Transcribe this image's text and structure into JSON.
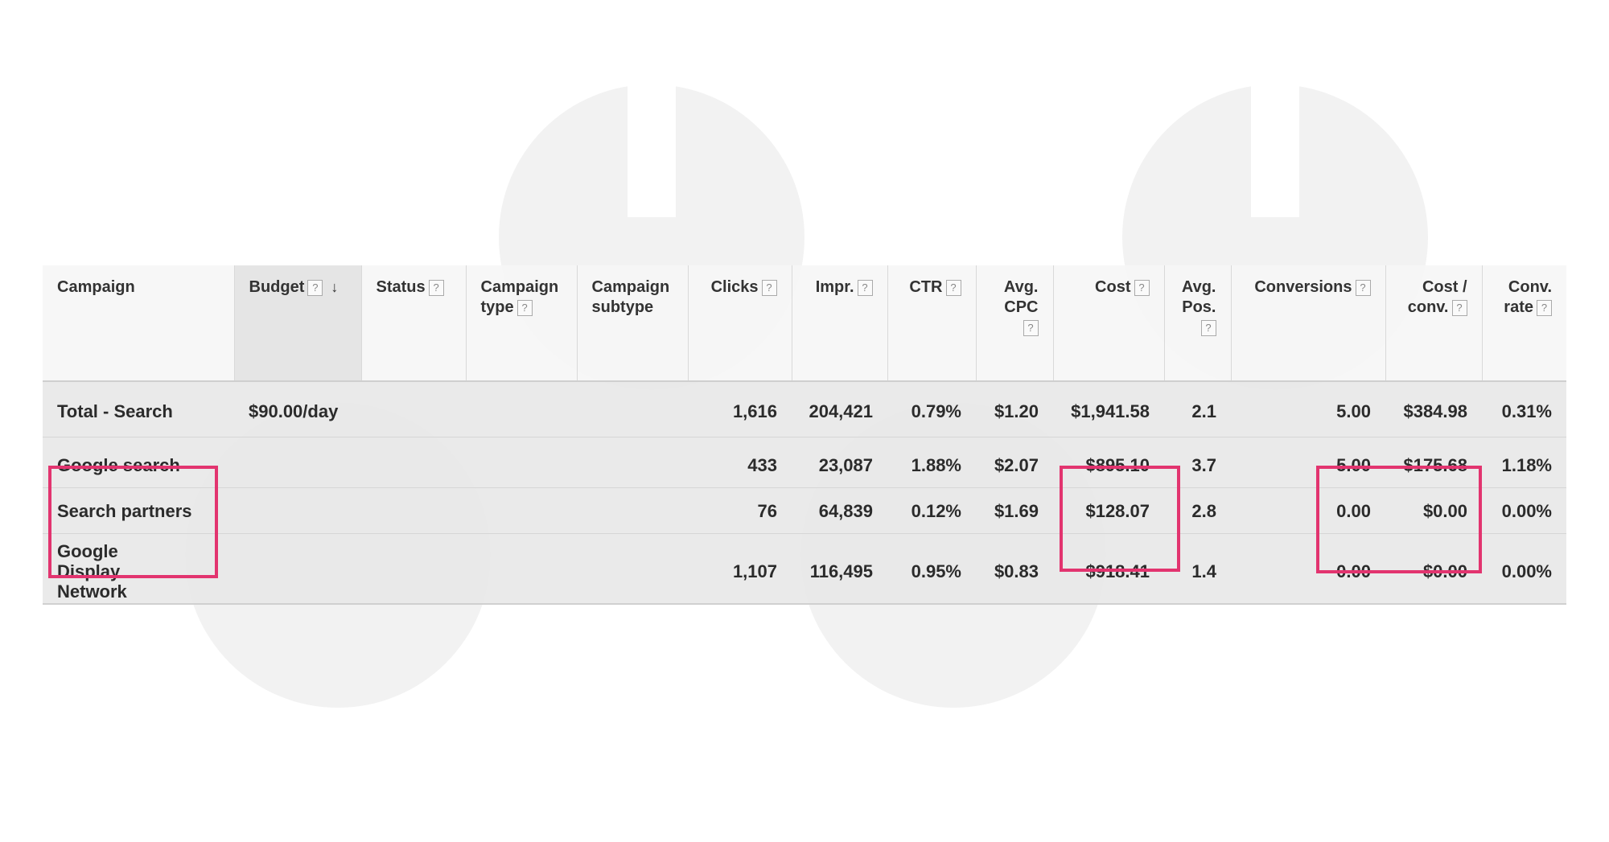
{
  "table": {
    "headers": [
      {
        "label": "Campaign",
        "help": false
      },
      {
        "label": "Budget",
        "help": true,
        "sorted": true,
        "sort_icon": "↓"
      },
      {
        "label": "Status",
        "help": true
      },
      {
        "label": "Campaign type",
        "help": true
      },
      {
        "label": "Campaign subtype",
        "help": false
      },
      {
        "label": "Clicks",
        "help": true
      },
      {
        "label": "Impr.",
        "help": true
      },
      {
        "label": "CTR",
        "help": true
      },
      {
        "label": "Avg. CPC",
        "help": true
      },
      {
        "label": "Cost",
        "help": true
      },
      {
        "label": "Avg. Pos.",
        "help": true
      },
      {
        "label": "Conversions",
        "help": true
      },
      {
        "label": "Cost / conv.",
        "help": true
      },
      {
        "label": "Conv. rate",
        "help": true
      }
    ],
    "help_icon": "?",
    "rows": [
      {
        "campaign": "Total - Search",
        "budget": "$90.00/day",
        "status": "",
        "type": "",
        "subtype": "",
        "clicks": "1,616",
        "impr": "204,421",
        "ctr": "0.79%",
        "avg_cpc": "$1.20",
        "cost": "$1,941.58",
        "avg_pos": "2.1",
        "conversions": "5.00",
        "cost_conv": "$384.98",
        "conv_rate": "0.31%"
      },
      {
        "campaign": "Google search",
        "budget": "",
        "status": "",
        "type": "",
        "subtype": "",
        "clicks": "433",
        "impr": "23,087",
        "ctr": "1.88%",
        "avg_cpc": "$2.07",
        "cost": "$895.10",
        "avg_pos": "3.7",
        "conversions": "5.00",
        "cost_conv": "$175.68",
        "conv_rate": "1.18%"
      },
      {
        "campaign": "Search partners",
        "budget": "",
        "status": "",
        "type": "",
        "subtype": "",
        "clicks": "76",
        "impr": "64,839",
        "ctr": "0.12%",
        "avg_cpc": "$1.69",
        "cost": "$128.07",
        "avg_pos": "2.8",
        "conversions": "0.00",
        "cost_conv": "$0.00",
        "conv_rate": "0.00%"
      },
      {
        "campaign": "Google Display Network",
        "budget": "",
        "status": "",
        "type": "",
        "subtype": "",
        "clicks": "1,107",
        "impr": "116,495",
        "ctr": "0.95%",
        "avg_cpc": "$0.83",
        "cost": "$918.41",
        "avg_pos": "1.4",
        "conversions": "0.00",
        "cost_conv": "$0.00",
        "conv_rate": "0.00%"
      }
    ]
  },
  "colors": {
    "highlight": "#e2346f",
    "row_bg": "#e8e8e8",
    "header_bg": "#f6f6f6"
  }
}
